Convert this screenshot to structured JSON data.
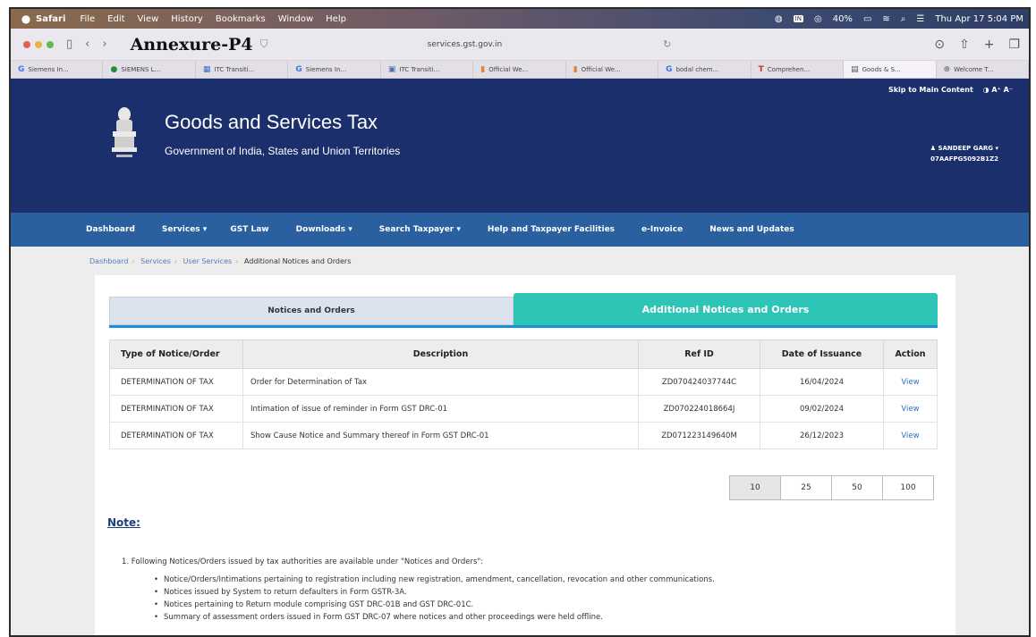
{
  "menubar": {
    "app": "Safari",
    "items": [
      "File",
      "Edit",
      "View",
      "History",
      "Bookmarks",
      "Window",
      "Help"
    ],
    "battery": "40%",
    "clock": "Thu Apr 17  5:04 PM"
  },
  "browser": {
    "doc_title": "Annexure-P4",
    "url": "services.gst.gov.in",
    "tabs": [
      {
        "icon": "G",
        "label": "Siemens In..."
      },
      {
        "icon": "●",
        "label": "SIEMENS L..."
      },
      {
        "icon": "▦",
        "label": "ITC Transiti..."
      },
      {
        "icon": "G",
        "label": "Siemens In..."
      },
      {
        "icon": "▣",
        "label": "ITC Transiti..."
      },
      {
        "icon": "▮",
        "label": "Official We..."
      },
      {
        "icon": "▮",
        "label": "Official We..."
      },
      {
        "icon": "G",
        "label": "bodal chem..."
      },
      {
        "icon": "T",
        "label": "Comprehen..."
      },
      {
        "icon": "▤",
        "label": "Goods & S..."
      },
      {
        "icon": "⊕",
        "label": "Welcome T..."
      }
    ]
  },
  "header": {
    "skip": "Skip to Main Content",
    "text_controls": "◑  A⁺  A⁻",
    "title": "Goods and Services Tax",
    "subtitle": "Government of India, States and Union Territories",
    "user_name": "♟ SANDEEP GARG ▾",
    "user_id": "07AAFPG5092B1Z2"
  },
  "nav": [
    "Dashboard",
    "Services ▾",
    "GST Law",
    "Downloads ▾",
    "Search Taxpayer ▾",
    "Help and Taxpayer Facilities",
    "e-Invoice",
    "News and Updates"
  ],
  "breadcrumb": [
    "Dashboard",
    "Services",
    "User Services",
    "Additional Notices and Orders"
  ],
  "toggle": {
    "notices": "Notices and Orders",
    "additional": "Additional Notices and Orders"
  },
  "table": {
    "headers": [
      "Type of Notice/Order",
      "Description",
      "Ref ID",
      "Date of Issuance",
      "Action"
    ],
    "rows": [
      [
        "DETERMINATION OF TAX",
        "Order for Determination of Tax",
        "ZD070424037744C",
        "16/04/2024",
        "View"
      ],
      [
        "DETERMINATION OF TAX",
        "Intimation of issue of reminder in Form GST DRC-01",
        "ZD070224018664J",
        "09/02/2024",
        "View"
      ],
      [
        "DETERMINATION OF TAX",
        "Show Cause Notice and Summary thereof in Form GST DRC-01",
        "ZD071223149640M",
        "26/12/2023",
        "View"
      ]
    ]
  },
  "pagination": [
    "10",
    "25",
    "50",
    "100"
  ],
  "note": {
    "title": "Note:",
    "item1": "1.  Following Notices/Orders issued by tax authorities are available under \"Notices and Orders\":",
    "bullets": [
      "Notice/Orders/Intimations pertaining to registration including new registration, amendment, cancellation, revocation and other communications.",
      "Notices issued by System to return defaulters in Form GSTR-3A.",
      "Notices pertaining to Return module comprising GST DRC-01B and GST DRC-01C.",
      "Summary of assessment orders issued in Form GST DRC-07 where notices and other proceedings were held offline."
    ]
  }
}
